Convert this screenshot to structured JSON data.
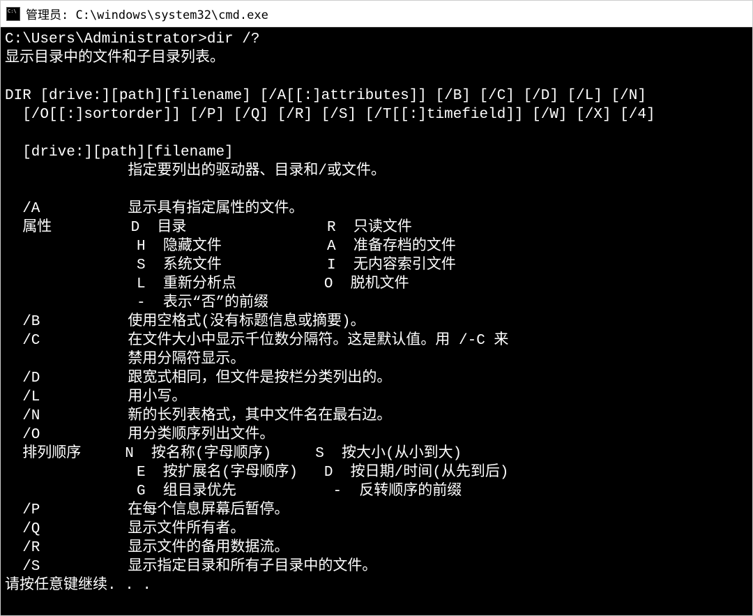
{
  "window": {
    "title": "管理员: C:\\windows\\system32\\cmd.exe"
  },
  "terminal": {
    "lines": [
      "C:\\Users\\Administrator>dir /?",
      "显示目录中的文件和子目录列表。",
      "",
      "DIR [drive:][path][filename] [/A[[:]attributes]] [/B] [/C] [/D] [/L] [/N]",
      "  [/O[[:]sortorder]] [/P] [/Q] [/R] [/S] [/T[[:]timefield]] [/W] [/X] [/4]",
      "",
      "  [drive:][path][filename]",
      "              指定要列出的驱动器、目录和/或文件。",
      "",
      "  /A          显示具有指定属性的文件。",
      "  属性         D  目录                R  只读文件",
      "               H  隐藏文件            A  准备存档的文件",
      "               S  系统文件            I  无内容索引文件",
      "               L  重新分析点          O  脱机文件",
      "               -  表示“否”的前缀",
      "  /B          使用空格式(没有标题信息或摘要)。",
      "  /C          在文件大小中显示千位数分隔符。这是默认值。用 /-C 来",
      "              禁用分隔符显示。",
      "  /D          跟宽式相同，但文件是按栏分类列出的。",
      "  /L          用小写。",
      "  /N          新的长列表格式，其中文件名在最右边。",
      "  /O          用分类顺序列出文件。",
      "  排列顺序     N  按名称(字母顺序)     S  按大小(从小到大)",
      "               E  按扩展名(字母顺序)   D  按日期/时间(从先到后)",
      "               G  组目录优先           -  反转顺序的前缀",
      "  /P          在每个信息屏幕后暂停。",
      "  /Q          显示文件所有者。",
      "  /R          显示文件的备用数据流。",
      "  /S          显示指定目录和所有子目录中的文件。",
      "请按任意键继续. . ."
    ]
  }
}
